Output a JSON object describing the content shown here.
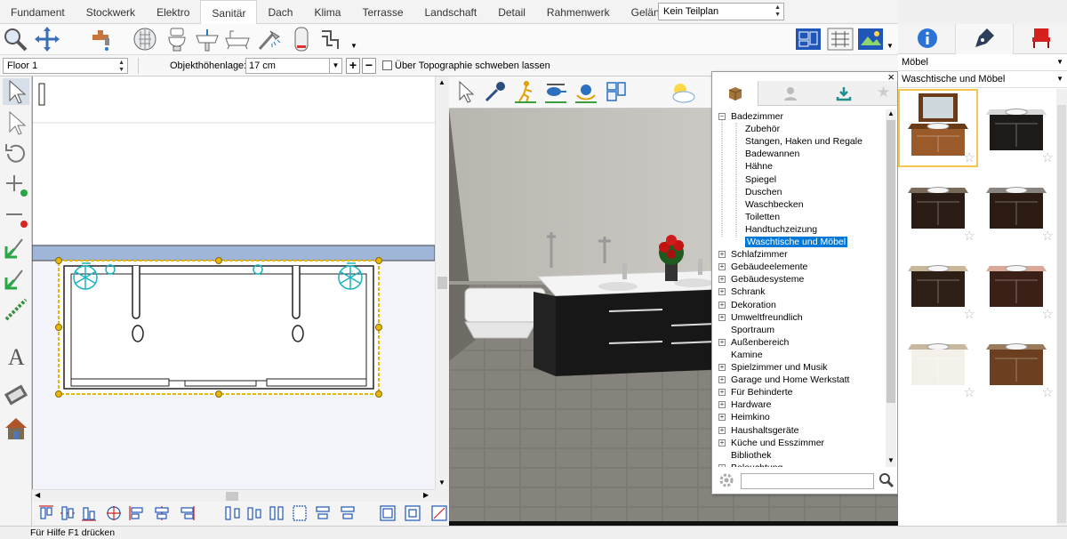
{
  "tabs": [
    "Fundament",
    "Stockwerk",
    "Elektro",
    "Sanitär",
    "Dach",
    "Klima",
    "Terrasse",
    "Landschaft",
    "Detail",
    "Rahmenwerk",
    "Gelände"
  ],
  "active_tab": "Sanitär",
  "plan_select": "Kein Teilplan",
  "options": {
    "floor": "Floor 1",
    "height_label": "Objekthöhenlage:",
    "height_value": "17 cm",
    "topography_label": "Über Topographie schweben lassen"
  },
  "catalog": {
    "category": "Möbel",
    "subcategory": "Waschtische und Möbel"
  },
  "library": {
    "tree": [
      {
        "label": "Badezimmer",
        "level": 0,
        "expander": "−"
      },
      {
        "label": "Zubehör",
        "level": 1
      },
      {
        "label": "Stangen, Haken und Regale",
        "level": 1
      },
      {
        "label": "Badewannen",
        "level": 1
      },
      {
        "label": "Hähne",
        "level": 1
      },
      {
        "label": "Spiegel",
        "level": 1
      },
      {
        "label": "Duschen",
        "level": 1
      },
      {
        "label": "Waschbecken",
        "level": 1
      },
      {
        "label": "Toiletten",
        "level": 1
      },
      {
        "label": "Handtuchzeizung",
        "level": 1
      },
      {
        "label": "Waschtische und Möbel",
        "level": 1,
        "selected": true
      },
      {
        "label": "Schlafzimmer",
        "level": 0,
        "expander": "+"
      },
      {
        "label": "Gebäudeelemente",
        "level": 0,
        "expander": "+"
      },
      {
        "label": "Gebäudesysteme",
        "level": 0,
        "expander": "+"
      },
      {
        "label": "Schrank",
        "level": 0,
        "expander": "+"
      },
      {
        "label": "Dekoration",
        "level": 0,
        "expander": "+"
      },
      {
        "label": "Umweltfreundlich",
        "level": 0,
        "expander": "+"
      },
      {
        "label": "Sportraum",
        "level": 0
      },
      {
        "label": "Außenbereich",
        "level": 0,
        "expander": "+"
      },
      {
        "label": "Kamine",
        "level": 0
      },
      {
        "label": "Spielzimmer und Musik",
        "level": 0,
        "expander": "+"
      },
      {
        "label": "Garage und Home Werkstatt",
        "level": 0,
        "expander": "+"
      },
      {
        "label": "Für Behinderte",
        "level": 0,
        "expander": "+"
      },
      {
        "label": "Hardware",
        "level": 0,
        "expander": "+"
      },
      {
        "label": "Heimkino",
        "level": 0,
        "expander": "+"
      },
      {
        "label": "Haushaltsgeräte",
        "level": 0,
        "expander": "+"
      },
      {
        "label": "Küche und Esszimmer",
        "level": 0,
        "expander": "+"
      },
      {
        "label": "Bibliothek",
        "level": 0
      },
      {
        "label": "Beleuchtung",
        "level": 0,
        "expander": "+"
      }
    ],
    "search_value": ""
  },
  "status": "Für Hilfe F1 drücken",
  "colors": {
    "accent": "#0078d7",
    "selection": "#f3c54e",
    "plan_selection": "#e8b800",
    "fixture": "#1ab3c4",
    "wall_band": "#9fb6d9"
  }
}
